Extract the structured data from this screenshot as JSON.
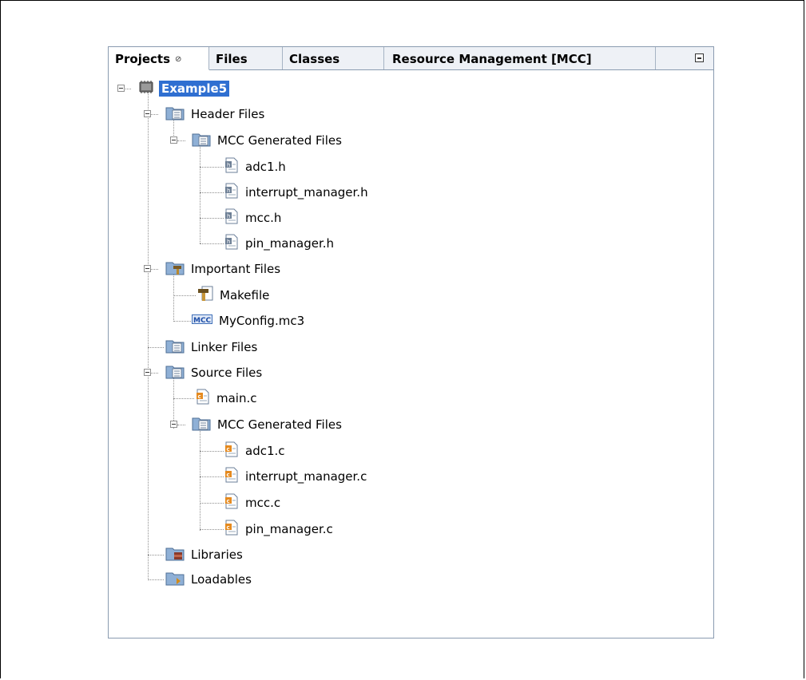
{
  "tabs": [
    {
      "label": "Projects",
      "close_glyph": "⊘"
    },
    {
      "label": "Files"
    },
    {
      "label": "Classes"
    },
    {
      "label": "Resource Management [MCC]"
    }
  ],
  "tree": {
    "root": "Example5",
    "header_files": "Header Files",
    "header_mcc": "MCC Generated Files",
    "header_items": [
      "adc1.h",
      "interrupt_manager.h",
      "mcc.h",
      "pin_manager.h"
    ],
    "important_files": "Important Files",
    "important_items": [
      "Makefile",
      "MyConfig.mc3"
    ],
    "linker_files": "Linker Files",
    "source_files": "Source Files",
    "source_main": "main.c",
    "source_mcc": "MCC Generated Files",
    "source_items": [
      "adc1.c",
      "interrupt_manager.c",
      "mcc.c",
      "pin_manager.c"
    ],
    "libraries": "Libraries",
    "loadables": "Loadables"
  },
  "icons": {
    "chip": "chip-icon",
    "folder": "folder-icon",
    "h_file": "header-file-icon",
    "c_file": "c-file-icon",
    "makefile": "makefile-icon",
    "mcc": "mcc-config-icon"
  },
  "colors": {
    "selection": "#2f6fd1",
    "folder": "#7a9cc6",
    "c_badge": "#e58a1f"
  },
  "mcc_badge_text": "MCC"
}
